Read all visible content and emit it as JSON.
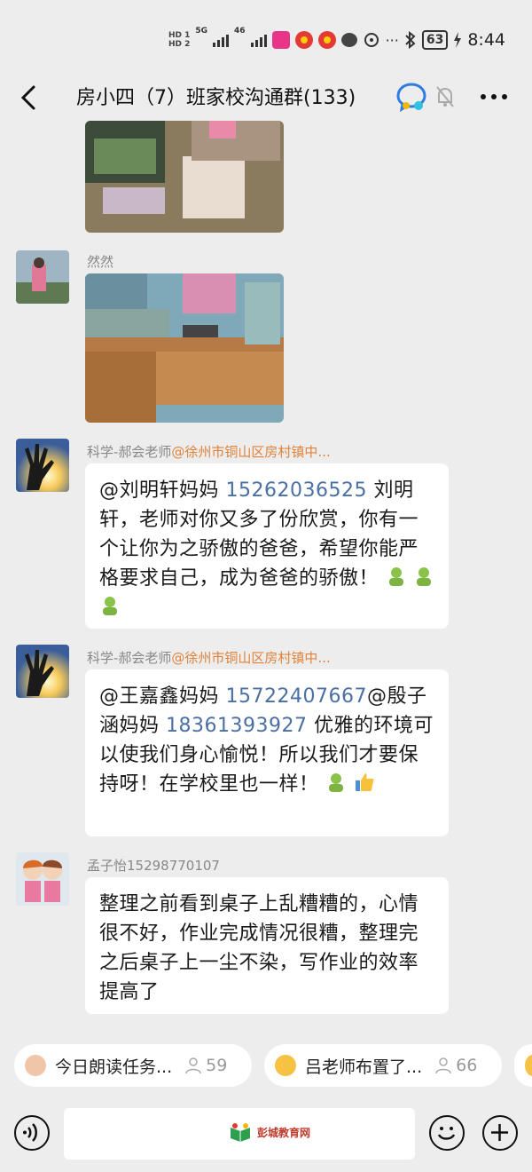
{
  "status_bar": {
    "hd1": "HD 1",
    "hd2": "HD 2",
    "net1": "5G",
    "net2": "46",
    "more": "···",
    "battery": "63",
    "time": "8:44"
  },
  "header": {
    "title": "房小四（7）班家校沟通群(133)",
    "icons": [
      "back-arrow",
      "chat-badge",
      "bell-muted",
      "more-dots"
    ]
  },
  "messages": [
    {
      "sender_name": "然然",
      "type": "image"
    },
    {
      "sender_name": "科学-郝会老师",
      "sender_tag": "@徐州市铜山区房村镇中...",
      "mention": "@刘明轩妈妈",
      "phone": "15262036525",
      "text": "刘明轩，老师对你又多了份欣赏，你有一个让你为之骄傲的爸爸，希望你能严格要求自己，成为爸爸的骄傲！"
    },
    {
      "sender_name": "科学-郝会老师",
      "sender_tag": "@徐州市铜山区房村镇中...",
      "mention1": "@王嘉鑫妈妈",
      "phone1": "15722407667",
      "mention2": "@殷子涵妈妈",
      "phone2": "18361393927",
      "text": "优雅的环境可以使我们身心愉悦！所以我们才要保持呀！在学校里也一样！"
    },
    {
      "sender_name": "孟子怡15298770107",
      "text": "整理之前看到桌子上乱糟糟的，心情很不好，作业完成情况很糟，整理完之后桌子上一尘不染，写作业的效率提高了"
    }
  ],
  "quick_bar": {
    "chip1_label": "今日朗读任务...",
    "chip1_count": "59",
    "chip2_label": "吕老师布置了...",
    "chip2_count": "66"
  },
  "input_bar": {
    "watermark": "彭城教育网"
  },
  "colors": {
    "background": "#ededed",
    "bubble": "#ffffff",
    "link_phone": "#4a6fa5",
    "mention_tag": "#e0823a"
  }
}
